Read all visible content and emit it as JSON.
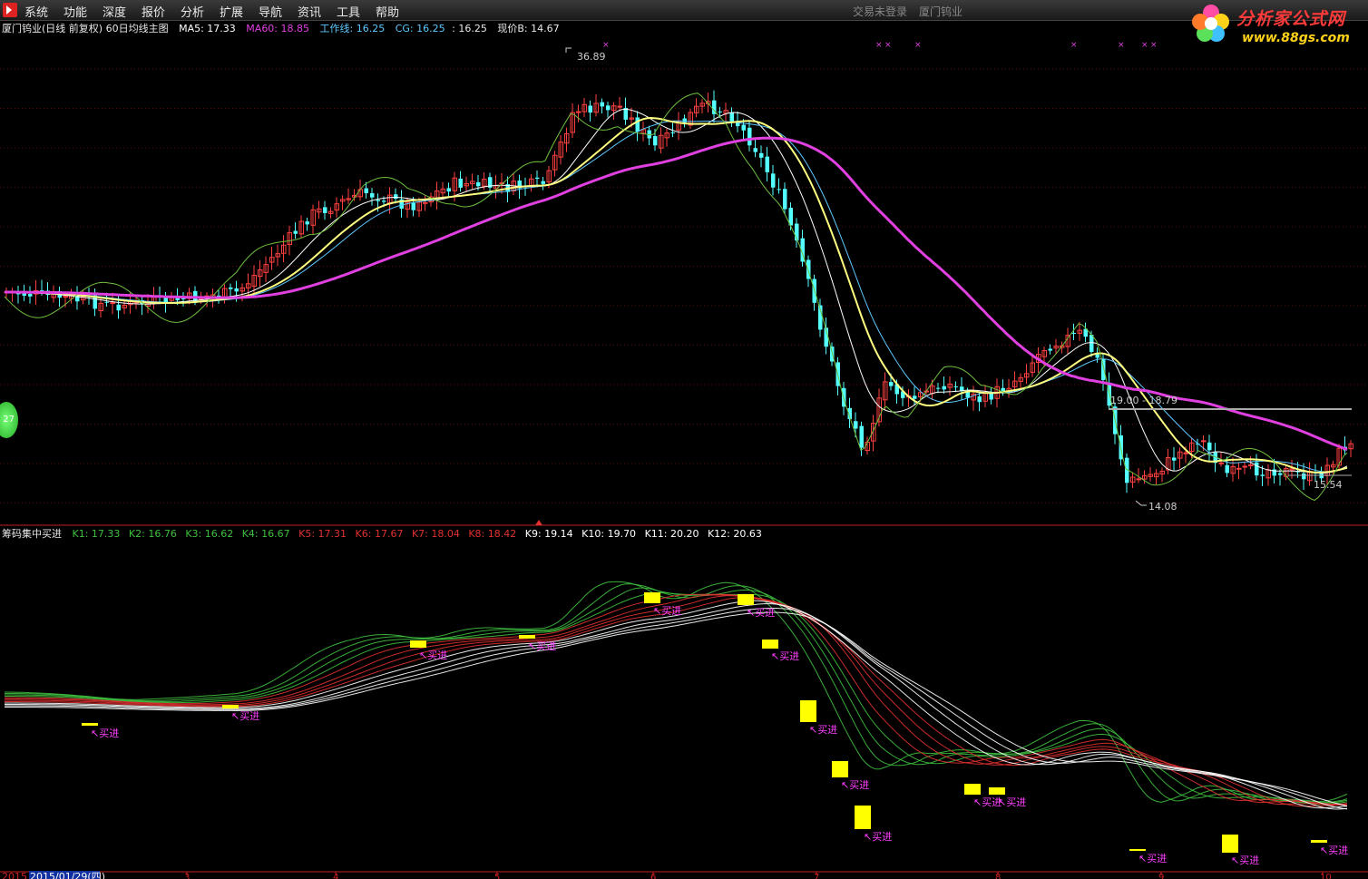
{
  "menu": {
    "items": [
      "系统",
      "功能",
      "深度",
      "报价",
      "分析",
      "扩展",
      "导航",
      "资讯",
      "工具",
      "帮助"
    ],
    "login_status": "交易未登录",
    "stock_name": "厦门钨业"
  },
  "brand": {
    "title": "分析家公式网",
    "url": "www.88gs.com"
  },
  "main_chart": {
    "header": {
      "title": "厦门钨业(日线 前复权) 60日均线主图",
      "ma5": "MA5: 17.33",
      "ma60": "MA60: 18.85",
      "work_line": "工作线: 16.25",
      "cg": "CG: 16.25",
      "cg_value": ": 16.25",
      "current_price": "现价B: 14.67"
    },
    "high_label": "36.89",
    "low_label": "14.08",
    "range_label": "19.00 - 18.79",
    "right_label": "15.54"
  },
  "indicator": {
    "title": "筹码集中买进",
    "k1": "K1: 17.33",
    "k2": "K2: 16.76",
    "k3": "K3: 16.62",
    "k4": "K4: 16.67",
    "k5": "K5: 17.31",
    "k6": "K6: 17.67",
    "k7": "K7: 18.04",
    "k8": "K8: 18.42",
    "k9": "K9: 19.14",
    "k10": "K10: 19.70",
    "k11": "K11: 20.20",
    "k12": "K12: 20.63",
    "signal_label": "买进"
  },
  "x_axis": {
    "start_year": "2015",
    "cursor_date": "2015/01/29(四)",
    "ticks": [
      "3",
      "4",
      "5",
      "6",
      "7",
      "8",
      "9",
      "10"
    ]
  },
  "side_badge": "27",
  "colors": {
    "ma5": "#ffffff",
    "ma60": "#e040e0",
    "work_line": "#5ec8ff",
    "cg": "#ffff80",
    "k_green": "#3fbf3f",
    "k_red": "#e03030",
    "k_white": "#ffffff",
    "candle_up": "#ff4040",
    "candle_down": "#54ffff",
    "buy_signal": "#ffff00",
    "buy_text": "#ff40ff"
  }
}
